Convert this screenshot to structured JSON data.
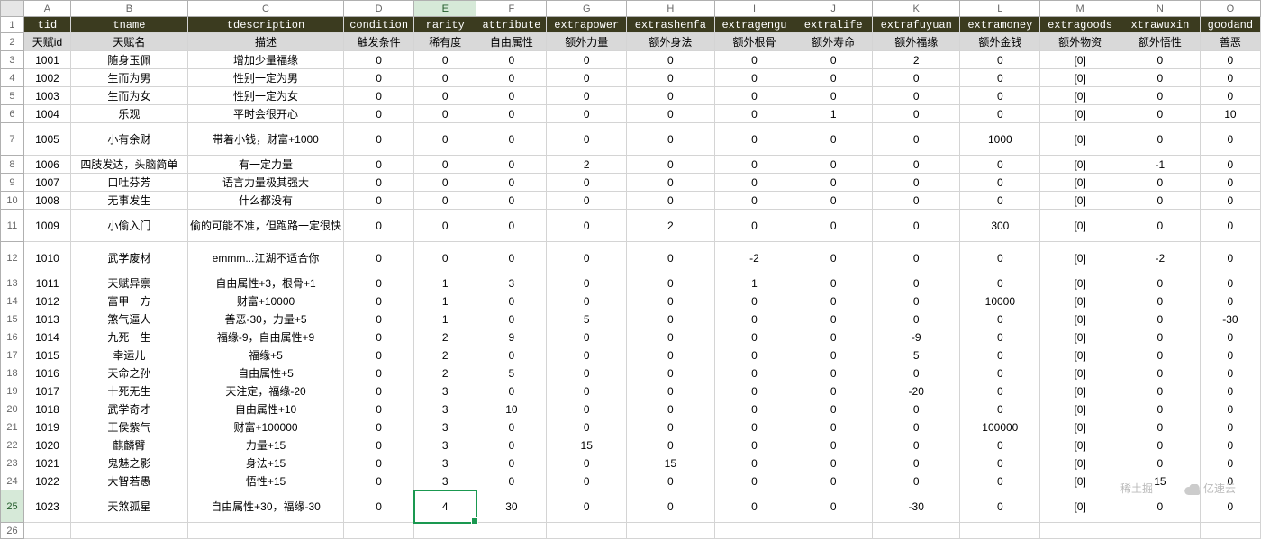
{
  "column_letters": [
    "A",
    "B",
    "C",
    "D",
    "E",
    "F",
    "G",
    "H",
    "I",
    "J",
    "K",
    "L",
    "M",
    "N",
    "O"
  ],
  "selected_col_index": 4,
  "selected_row_index": 24,
  "header1": [
    "tid",
    "tname",
    "tdescription",
    "condition",
    "rarity",
    "attribute",
    "extrapower",
    "extrashenfa",
    "extragengu",
    "extralife",
    "extrafuyuan",
    "extramoney",
    "extragoods",
    "xtrawuxin",
    "goodand"
  ],
  "header2": [
    "天赋id",
    "天赋名",
    "描述",
    "触发条件",
    "稀有度",
    "自由属性",
    "额外力量",
    "额外身法",
    "额外根骨",
    "额外寿命",
    "额外福缘",
    "额外金钱",
    "额外物资",
    "额外悟性",
    "善恶"
  ],
  "rows": [
    {
      "n": 3,
      "cells": [
        "1001",
        "随身玉佩",
        "增加少量福缘",
        "0",
        "0",
        "0",
        "0",
        "0",
        "0",
        "0",
        "2",
        "0",
        "[0]",
        "0",
        "0"
      ]
    },
    {
      "n": 4,
      "cells": [
        "1002",
        "生而为男",
        "性别一定为男",
        "0",
        "0",
        "0",
        "0",
        "0",
        "0",
        "0",
        "0",
        "0",
        "[0]",
        "0",
        "0"
      ]
    },
    {
      "n": 5,
      "cells": [
        "1003",
        "生而为女",
        "性别一定为女",
        "0",
        "0",
        "0",
        "0",
        "0",
        "0",
        "0",
        "0",
        "0",
        "[0]",
        "0",
        "0"
      ]
    },
    {
      "n": 6,
      "cells": [
        "1004",
        "乐观",
        "平时会很开心",
        "0",
        "0",
        "0",
        "0",
        "0",
        "0",
        "1",
        "0",
        "0",
        "[0]",
        "0",
        "10"
      ]
    },
    {
      "n": 7,
      "cells": [
        "1005",
        "小有余财",
        "带着小钱，财富+1000",
        "0",
        "0",
        "0",
        "0",
        "0",
        "0",
        "0",
        "0",
        "1000",
        "[0]",
        "0",
        "0"
      ]
    },
    {
      "n": 8,
      "cells": [
        "1006",
        "四肢发达，头脑简单",
        "有一定力量",
        "0",
        "0",
        "0",
        "2",
        "0",
        "0",
        "0",
        "0",
        "0",
        "[0]",
        "-1",
        "0"
      ]
    },
    {
      "n": 9,
      "cells": [
        "1007",
        "口吐芬芳",
        "语言力量极其强大",
        "0",
        "0",
        "0",
        "0",
        "0",
        "0",
        "0",
        "0",
        "0",
        "[0]",
        "0",
        "0"
      ]
    },
    {
      "n": 10,
      "cells": [
        "1008",
        "无事发生",
        "什么都没有",
        "0",
        "0",
        "0",
        "0",
        "0",
        "0",
        "0",
        "0",
        "0",
        "[0]",
        "0",
        "0"
      ]
    },
    {
      "n": 11,
      "cells": [
        "1009",
        "小偷入门",
        "偷的可能不准，但跑路一定很快",
        "0",
        "0",
        "0",
        "0",
        "2",
        "0",
        "0",
        "0",
        "300",
        "[0]",
        "0",
        "0"
      ]
    },
    {
      "n": 12,
      "cells": [
        "1010",
        "武学废材",
        "emmm...江湖不适合你",
        "0",
        "0",
        "0",
        "0",
        "0",
        "-2",
        "0",
        "0",
        "0",
        "[0]",
        "-2",
        "0"
      ]
    },
    {
      "n": 13,
      "cells": [
        "1011",
        "天赋异禀",
        "自由属性+3，根骨+1",
        "0",
        "1",
        "3",
        "0",
        "0",
        "1",
        "0",
        "0",
        "0",
        "[0]",
        "0",
        "0"
      ]
    },
    {
      "n": 14,
      "cells": [
        "1012",
        "富甲一方",
        "财富+10000",
        "0",
        "1",
        "0",
        "0",
        "0",
        "0",
        "0",
        "0",
        "10000",
        "[0]",
        "0",
        "0"
      ]
    },
    {
      "n": 15,
      "cells": [
        "1013",
        "煞气逼人",
        "善恶-30，力量+5",
        "0",
        "1",
        "0",
        "5",
        "0",
        "0",
        "0",
        "0",
        "0",
        "[0]",
        "0",
        "-30"
      ]
    },
    {
      "n": 16,
      "cells": [
        "1014",
        "九死一生",
        "福缘-9，自由属性+9",
        "0",
        "2",
        "9",
        "0",
        "0",
        "0",
        "0",
        "-9",
        "0",
        "[0]",
        "0",
        "0"
      ]
    },
    {
      "n": 17,
      "cells": [
        "1015",
        "幸运儿",
        "福缘+5",
        "0",
        "2",
        "0",
        "0",
        "0",
        "0",
        "0",
        "5",
        "0",
        "[0]",
        "0",
        "0"
      ]
    },
    {
      "n": 18,
      "cells": [
        "1016",
        "天命之孙",
        "自由属性+5",
        "0",
        "2",
        "5",
        "0",
        "0",
        "0",
        "0",
        "0",
        "0",
        "[0]",
        "0",
        "0"
      ]
    },
    {
      "n": 19,
      "cells": [
        "1017",
        "十死无生",
        "天注定，福缘-20",
        "0",
        "3",
        "0",
        "0",
        "0",
        "0",
        "0",
        "-20",
        "0",
        "[0]",
        "0",
        "0"
      ]
    },
    {
      "n": 20,
      "cells": [
        "1018",
        "武学奇才",
        "自由属性+10",
        "0",
        "3",
        "10",
        "0",
        "0",
        "0",
        "0",
        "0",
        "0",
        "[0]",
        "0",
        "0"
      ]
    },
    {
      "n": 21,
      "cells": [
        "1019",
        "王侯紫气",
        "财富+100000",
        "0",
        "3",
        "0",
        "0",
        "0",
        "0",
        "0",
        "0",
        "100000",
        "[0]",
        "0",
        "0"
      ]
    },
    {
      "n": 22,
      "cells": [
        "1020",
        "麒麟臂",
        "力量+15",
        "0",
        "3",
        "0",
        "15",
        "0",
        "0",
        "0",
        "0",
        "0",
        "[0]",
        "0",
        "0"
      ]
    },
    {
      "n": 23,
      "cells": [
        "1021",
        "鬼魅之影",
        "身法+15",
        "0",
        "3",
        "0",
        "0",
        "15",
        "0",
        "0",
        "0",
        "0",
        "[0]",
        "0",
        "0"
      ]
    },
    {
      "n": 24,
      "cells": [
        "1022",
        "大智若愚",
        "悟性+15",
        "0",
        "3",
        "0",
        "0",
        "0",
        "0",
        "0",
        "0",
        "0",
        "[0]",
        "15",
        "0"
      ]
    },
    {
      "n": 25,
      "cells": [
        "1023",
        "天煞孤星",
        "自由属性+30，福缘-30",
        "0",
        "4",
        "30",
        "0",
        "0",
        "0",
        "0",
        "-30",
        "0",
        "[0]",
        "0",
        "0"
      ]
    },
    {
      "n": 26,
      "cells": [
        "",
        "",
        "",
        "",
        "",
        "",
        "",
        "",
        "",
        "",
        "",
        "",
        "",
        "",
        ""
      ]
    }
  ],
  "watermark1": "稀土掘",
  "watermark2": "亿速云"
}
